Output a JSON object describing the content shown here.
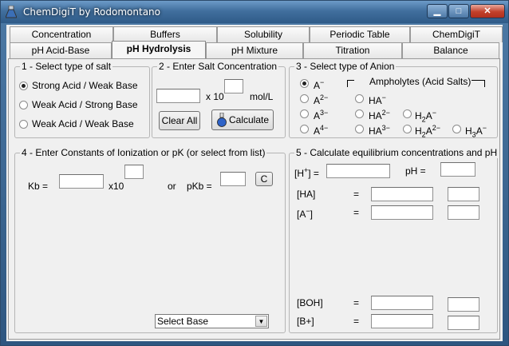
{
  "window": {
    "title": "ChemDigiT by Rodomontano",
    "minimize": "▁",
    "maximize": "□",
    "close": "✕"
  },
  "tabs_back": [
    "Concentration",
    "Buffers",
    "Solubility",
    "Periodic Table",
    "ChemDigiT"
  ],
  "tabs_front": [
    "pH Acid-Base",
    "pH Hydrolysis",
    "pH Mixture",
    "Titration",
    "Balance"
  ],
  "active_tab": "pH Hydrolysis",
  "salt": {
    "legend": "1 - Select type of salt",
    "options": [
      "Strong Acid  /  Weak Base",
      "Weak Acid  /  Strong Base",
      "Weak Acid  /  Weak Base"
    ],
    "selected": 0
  },
  "conc": {
    "legend": "2 - Enter Salt Concentration",
    "x10": "x 10",
    "unit": "mol/L",
    "clear": "Clear All",
    "calc": "Calculate"
  },
  "anion": {
    "legend": "3 - Select type of Anion",
    "ampholytes": "Ampholytes (Acid Salts)",
    "a1": "A",
    "a1s": "−",
    "a2": "A",
    "a2s": "2−",
    "a3": "A",
    "a3s": "3−",
    "a4": "A",
    "a4s": "4−",
    "h1": "HA",
    "h1s": "−",
    "h2": "HA",
    "h2s": "2−",
    "h3": "HA",
    "h3s": "3−",
    "h2a_a": "H",
    "h2a_b": "2",
    "h2a_c": "A",
    "h2a_s": "−",
    "h2a2_a": "H",
    "h2a2_b": "2",
    "h2a2_c": "A",
    "h2a2_s": "2−",
    "h3a_a": "H",
    "h3a_b": "3",
    "h3a_c": "A",
    "h3a_s": "−"
  },
  "constants": {
    "legend": "4 - Enter Constants of Ionization or pK (or select from list)",
    "kb": "Kb  =",
    "x10": "x10",
    "or": "or",
    "pkb": "pKb  =",
    "c_button": "C",
    "select": "Select Base"
  },
  "equil": {
    "legend": "5 - Calculate equilibrium concentrations and pH",
    "hplus_a": "[H",
    "hplus_s": "+",
    "hplus_b": "] =",
    "ph": "pH   =",
    "ha": "[HA]",
    "a_a": "[A",
    "a_s": "−",
    "a_b": "]",
    "boh": "[BOH]",
    "bplus": "[B+]",
    "eq": "="
  }
}
